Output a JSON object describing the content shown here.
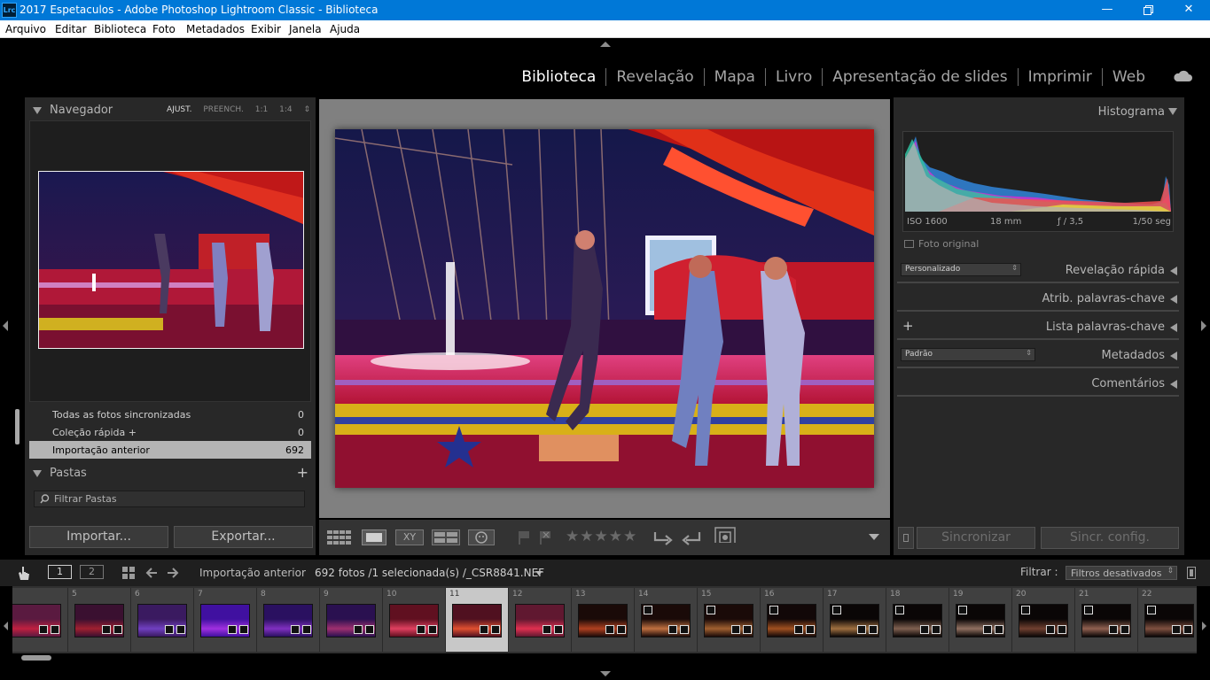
{
  "window": {
    "app_icon": "Lrc",
    "title": "2017 Espetaculos - Adobe Photoshop Lightroom Classic - Biblioteca",
    "minimize_icon": "minimize-icon",
    "maximize_icon": "restore-icon",
    "close_icon": "close-icon"
  },
  "menu": [
    "Arquivo",
    "Editar",
    "Biblioteca",
    "Foto",
    "Metadados",
    "Exibir",
    "Janela",
    "Ajuda"
  ],
  "modules": [
    "Biblioteca",
    "Revelação",
    "Mapa",
    "Livro",
    "Apresentação de slides",
    "Imprimir",
    "Web"
  ],
  "active_module": "Biblioteca",
  "left_panel": {
    "navigator": {
      "title": "Navegador",
      "options": [
        "AJUST.",
        "PREENCH.",
        "1:1",
        "1:4"
      ],
      "active_option": "AJUST.",
      "stepper": "⇕"
    },
    "catalog": [
      {
        "label": "Todas as fotos sincronizadas",
        "count": "0"
      },
      {
        "label": "Coleção rápida",
        "plus": "+",
        "count": "0"
      },
      {
        "label": "Importação anterior",
        "count": "692",
        "selected": true
      }
    ],
    "folders": {
      "title": "Pastas",
      "add": "+",
      "filter_placeholder": "Filtrar Pastas"
    },
    "import_button": "Importar...",
    "export_button": "Exportar..."
  },
  "toolbar": {
    "view_icons": [
      "grid-view-icon",
      "loupe-view-icon",
      "compare-view-icon",
      "survey-view-icon",
      "people-view-icon"
    ],
    "compare_label": "XY",
    "flag_icons": [
      "flag-icon",
      "reject-flag-icon"
    ],
    "stars": "★★★★★",
    "rating": 0,
    "rotate_icons": [
      "rotate-left-icon",
      "rotate-right-icon"
    ],
    "crop_icon": "crop-icon",
    "dropdown_icon": "chevron-down-icon"
  },
  "right_panel": {
    "histogram": {
      "title": "Histograma",
      "iso": "ISO 1600",
      "focal": "18 mm",
      "aperture": "ƒ / 3,5",
      "shutter": "1/50 seg",
      "original_photo": "Foto original"
    },
    "quick_develop": {
      "title": "Revelação rápida",
      "preset": "Personalizado"
    },
    "keywording": {
      "title": "Atrib. palavras-chave"
    },
    "keyword_list": {
      "title": "Lista palavras-chave",
      "add": "+"
    },
    "metadata": {
      "title": "Metadados",
      "preset": "Padrão"
    },
    "comments": {
      "title": "Comentários"
    },
    "sync_button": "Sincronizar",
    "sync_settings_button": "Sincr. config."
  },
  "filmstrip_bar": {
    "page1": "1",
    "page2": "2",
    "source": "Importação anterior",
    "info": "692 fotos /1 selecionada(s) /_CSR8841.NEF",
    "filter_label": "Filtrar :",
    "filter_value": "Filtros desativados"
  },
  "filmstrip": {
    "selected": "11",
    "numbers": [
      "",
      "5",
      "6",
      "7",
      "8",
      "9",
      "10",
      "11",
      "12",
      "13",
      "14",
      "15",
      "16",
      "17",
      "18",
      "19",
      "20",
      "21",
      "22"
    ]
  },
  "colors": {
    "titlebar": "#0078d7",
    "panel": "#282828",
    "center_bg": "#808080",
    "selected_row": "#b4b4b4",
    "active_text": "#ffffff",
    "inactive_text": "#a6a6a6"
  }
}
